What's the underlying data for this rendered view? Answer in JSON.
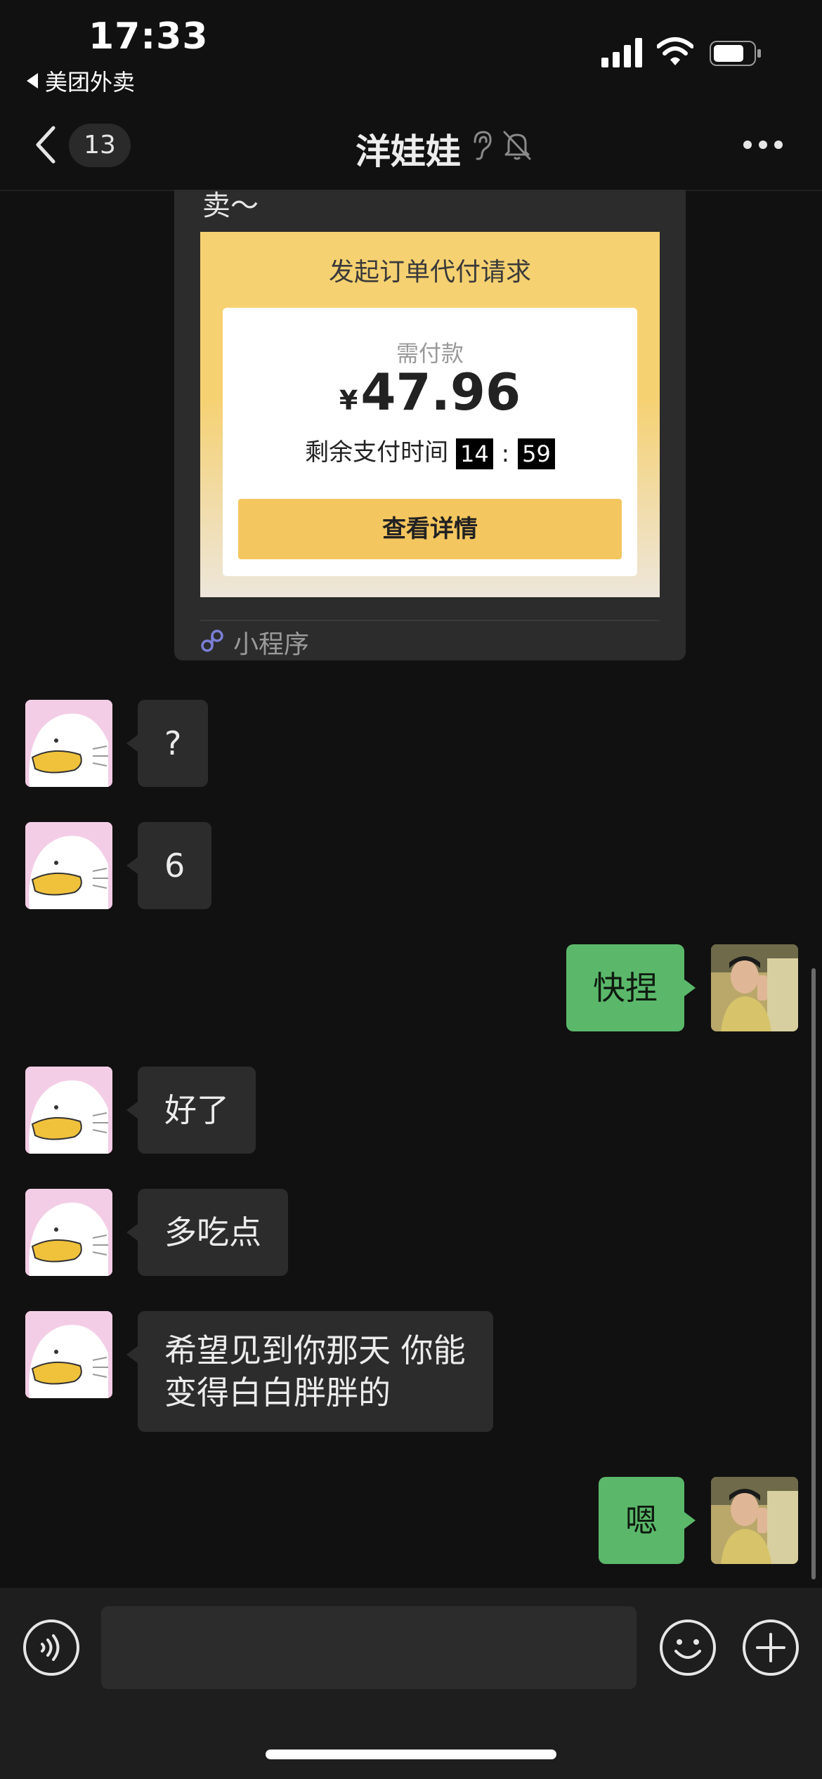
{
  "status_bar": {
    "time": "17:33",
    "back_app_label": "美团外卖",
    "icons": [
      "signal-icon",
      "wifi-icon",
      "battery-icon"
    ]
  },
  "nav": {
    "unread_count": "13",
    "title": "洋娃娃",
    "icons": [
      "chevron-left-icon",
      "ear-icon",
      "bell-muted-icon",
      "more-icon"
    ]
  },
  "mini_program_card": {
    "top_text": "卖～",
    "preview_title": "发起订单代付请求",
    "amount_label": "需付款",
    "currency": "¥",
    "amount": "47.96",
    "time_label": "剩余支付时间",
    "minutes": "14",
    "colon": ":",
    "seconds": "59",
    "detail_button": "查看详情",
    "source_label": "小程序"
  },
  "messages": [
    {
      "side": "in",
      "text": "?"
    },
    {
      "side": "in",
      "text": "6"
    },
    {
      "side": "out",
      "text": "快捏"
    },
    {
      "side": "in",
      "text": "好了"
    },
    {
      "side": "in",
      "text": "多吃点"
    },
    {
      "side": "in",
      "text": "希望见到你那天 你能变得白白胖胖的"
    },
    {
      "side": "out",
      "text": "嗯"
    }
  ],
  "input_bar": {
    "placeholder": "",
    "icons": [
      "voice-icon",
      "emoji-icon",
      "plus-icon"
    ]
  },
  "colors": {
    "background": "#111111",
    "incoming_bubble": "#2c2c2c",
    "outgoing_bubble": "#5bb86a",
    "card_yellow": "#f6d171",
    "button_yellow": "#f4c65f"
  }
}
